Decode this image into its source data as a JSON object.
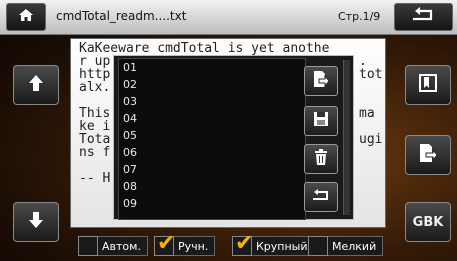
{
  "header": {
    "file_title": "cmdTotal_readm....txt",
    "page": "Стр.1/9"
  },
  "text_lines": [
    "KaKeeware cmdTotal is yet anothe",
    "r up",
    "http",
    "alx.",
    "",
    "This",
    "ke i",
    "Tota",
    "ns f",
    "",
    "-- H"
  ],
  "text_right_fragments": [
    {
      "line": 1,
      "text": "."
    },
    {
      "line": 2,
      "text": "tot"
    },
    {
      "line": 5,
      "text": "ma"
    },
    {
      "line": 7,
      "text": "ugi"
    }
  ],
  "list": {
    "items": [
      "01",
      "02",
      "03",
      "04",
      "05",
      "06",
      "07",
      "08",
      "09"
    ]
  },
  "right_panel": {
    "gbk_label": "GBK"
  },
  "options": [
    {
      "label": "Автом.",
      "checked": false
    },
    {
      "label": "Ручн.",
      "checked": true
    },
    {
      "label": "Крупный",
      "checked": true
    },
    {
      "label": "Мелкий",
      "checked": false
    }
  ],
  "colors": {
    "accent_check": "#f5b400"
  },
  "icons": {
    "home": "home-icon",
    "back": "return-arrow-icon",
    "up": "arrow-up-icon",
    "down": "arrow-down-icon",
    "bookmark": "bookmark-icon",
    "export": "export-doc-icon",
    "save": "save-icon",
    "delete": "trash-icon",
    "return": "return-arrow-icon"
  }
}
